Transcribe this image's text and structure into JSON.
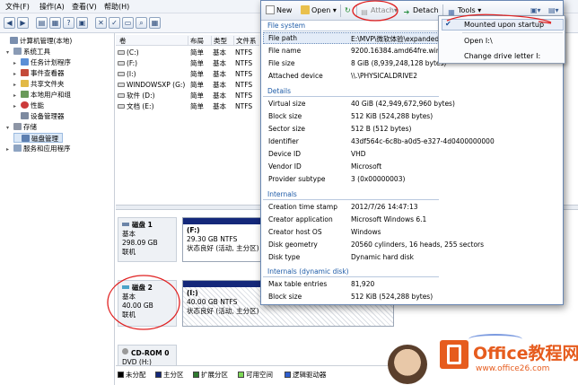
{
  "mgmt": {
    "menu": [
      "文件(F)",
      "操作(A)",
      "查看(V)",
      "帮助(H)"
    ],
    "tree": [
      {
        "label": "计算机管理(本地)",
        "level": 0,
        "twisty": ""
      },
      {
        "label": "系统工具",
        "level": 1,
        "twisty": "▾"
      },
      {
        "label": "任务计划程序",
        "level": 2,
        "twisty": "▸"
      },
      {
        "label": "事件查看器",
        "level": 2,
        "twisty": "▸"
      },
      {
        "label": "共享文件夹",
        "level": 2,
        "twisty": "▸"
      },
      {
        "label": "本地用户和组",
        "level": 2,
        "twisty": "▸"
      },
      {
        "label": "性能",
        "level": 2,
        "twisty": "▸"
      },
      {
        "label": "设备管理器",
        "level": 2,
        "twisty": ""
      },
      {
        "label": "存储",
        "level": 1,
        "twisty": "▾"
      },
      {
        "label": "磁盘管理",
        "level": 2,
        "twisty": ""
      },
      {
        "label": "服务和应用程序",
        "level": 1,
        "twisty": "▸"
      }
    ],
    "volume_headers": [
      "卷",
      "布局",
      "类型",
      "文件系"
    ],
    "volumes": [
      {
        "name": "(C:)",
        "layout": "简单",
        "type": "基本",
        "fs": "NTFS"
      },
      {
        "name": "(F:)",
        "layout": "简单",
        "type": "基本",
        "fs": "NTFS"
      },
      {
        "name": "(I:)",
        "layout": "简单",
        "type": "基本",
        "fs": "NTFS"
      },
      {
        "name": "WINDOWSXP (G:)",
        "layout": "简单",
        "type": "基本",
        "fs": "NTFS"
      },
      {
        "name": "软件 (D:)",
        "layout": "简单",
        "type": "基本",
        "fs": "NTFS"
      },
      {
        "name": "文档 (E:)",
        "layout": "简单",
        "type": "基本",
        "fs": "NTFS"
      }
    ],
    "disks": [
      {
        "name": "磁盘 1",
        "kind": "基本",
        "size": "298.09 GB",
        "status": "联机",
        "partition": {
          "name": "(F:)",
          "size": "29.30 GB NTFS",
          "status": "状态良好 (活动, 主分区)"
        }
      },
      {
        "name": "磁盘 2",
        "kind": "基本",
        "size": "40.00 GB",
        "status": "联机",
        "partition": {
          "name": "(I:)",
          "size": "40.00 GB NTFS",
          "status": "状态良好 (活动, 主分区)"
        }
      },
      {
        "name": "CD-ROM 0",
        "kind": "DVD (H:)",
        "size": "",
        "status": ""
      }
    ],
    "legend": [
      {
        "label": "未分配",
        "color": "#000000"
      },
      {
        "label": "主分区",
        "color": "#14287a"
      },
      {
        "label": "扩展分区",
        "color": "#2f7a2f"
      },
      {
        "label": "可用空间",
        "color": "#7ed957"
      },
      {
        "label": "逻辑驱动器",
        "color": "#2f5fd0"
      }
    ]
  },
  "vhd": {
    "toolbar": {
      "new": "New",
      "open": "Open",
      "attach": "Attach",
      "detach": "Detach",
      "tools": "Tools"
    },
    "sections": {
      "file_system": "File system",
      "details": "Details",
      "internals": "Internals",
      "internals_dynamic": "Internals (dynamic disk)"
    },
    "file_system_rows": [
      {
        "key": "File path",
        "value": "E:\\MVP\\微软体验\\expandedV"
      },
      {
        "key": "File name",
        "value": "9200.16384.amd64fre.win8_r"
      },
      {
        "key": "File size",
        "value": "8 GiB (8,939,248,128 bytes)"
      },
      {
        "key": "Attached device",
        "value": "\\\\.\\PHYSICALDRIVE2"
      }
    ],
    "details_rows": [
      {
        "key": "Virtual size",
        "value": "40 GiB (42,949,672,960 bytes)"
      },
      {
        "key": "Block size",
        "value": "512 KiB (524,288 bytes)"
      },
      {
        "key": "Sector size",
        "value": "512 B (512 bytes)"
      },
      {
        "key": "Identifier",
        "value": "43df564c-6c8b-a0d5-e327-4d0400000000"
      },
      {
        "key": "Device ID",
        "value": "VHD"
      },
      {
        "key": "Vendor ID",
        "value": "Microsoft"
      },
      {
        "key": "Provider subtype",
        "value": "3 (0x00000003)"
      }
    ],
    "internals_rows": [
      {
        "key": "Creation time stamp",
        "value": "2012/7/26 14:47:13"
      },
      {
        "key": "Creator application",
        "value": "Microsoft Windows 6.1"
      },
      {
        "key": "Creator host OS",
        "value": "Windows"
      },
      {
        "key": "Disk geometry",
        "value": "20560 cylinders, 16 heads, 255 sectors"
      },
      {
        "key": "Disk type",
        "value": "Dynamic hard disk"
      }
    ],
    "dynamic_rows": [
      {
        "key": "Max table entries",
        "value": "81,920"
      },
      {
        "key": "Block size",
        "value": "512 KiB (524,288 bytes)"
      }
    ]
  },
  "tools_menu": {
    "mounted": "Mounted upon startup",
    "open": "Open I:\\",
    "change": "Change drive letter I:"
  },
  "watermark": {
    "title": "Office教程网",
    "url": "www.office26.com"
  }
}
